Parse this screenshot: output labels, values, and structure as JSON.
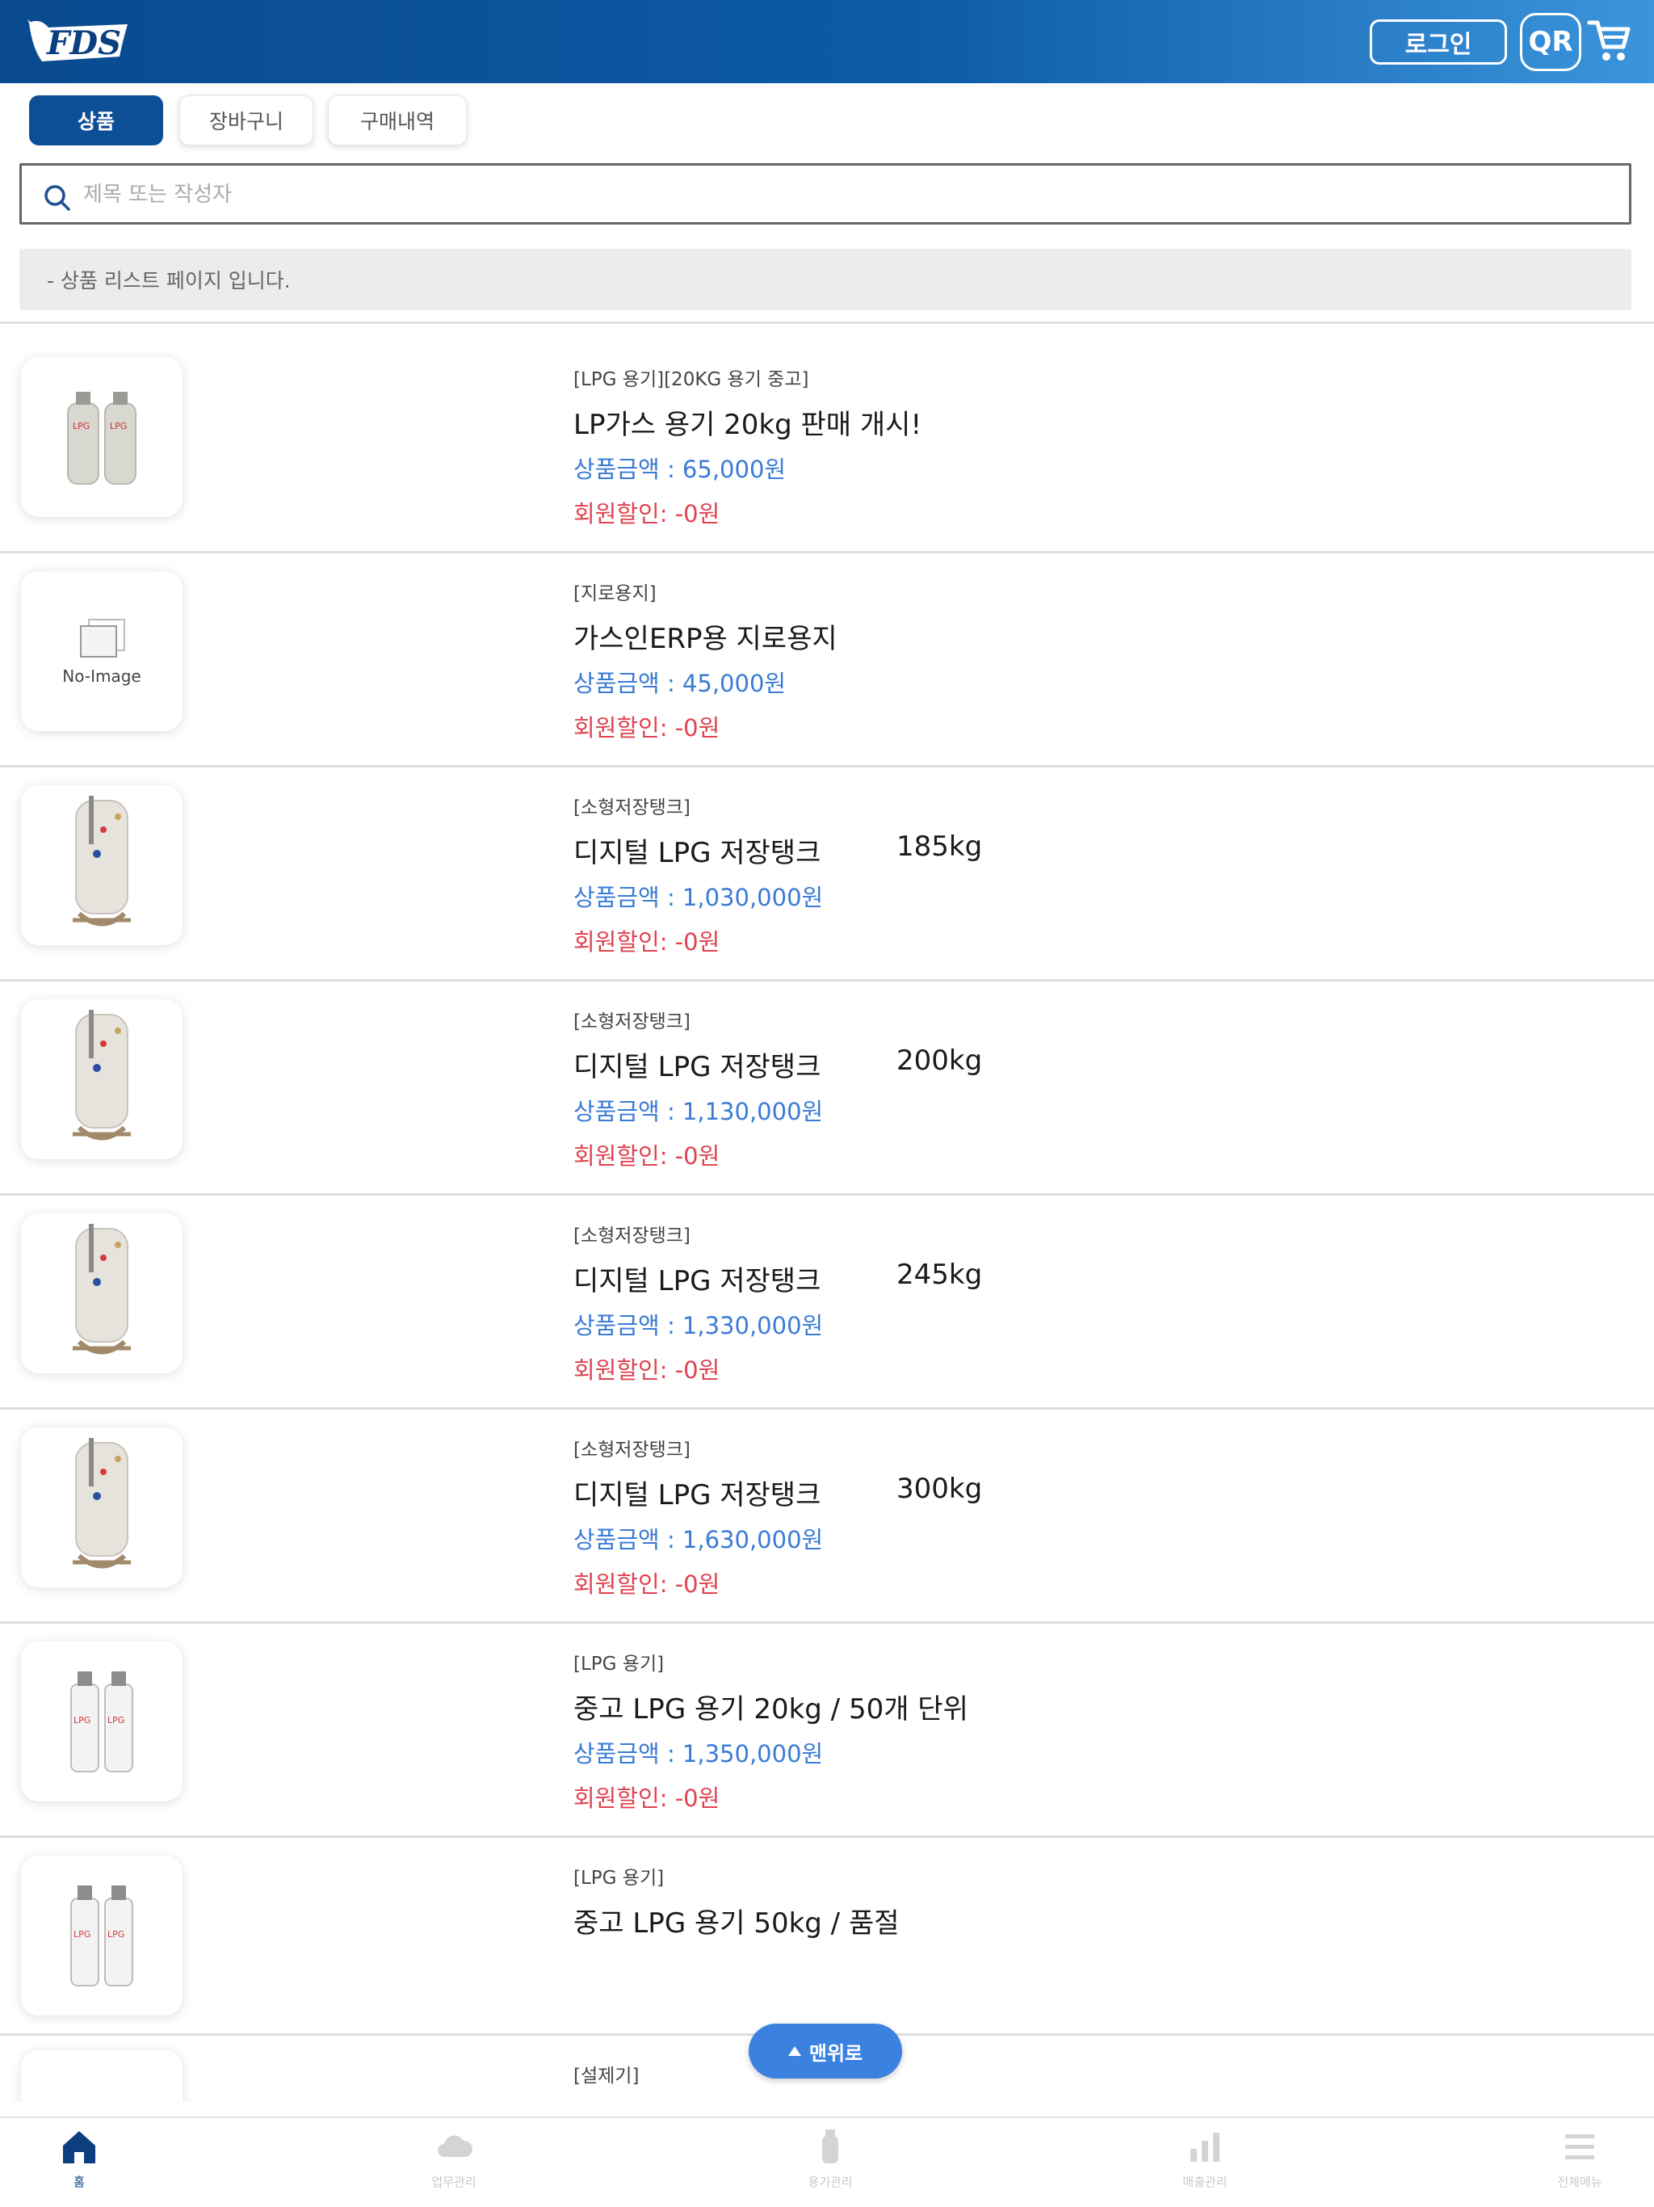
{
  "header": {
    "logo_text": "FDS",
    "login_label": "로그인",
    "qr_label": "QR",
    "cart_icon": "cart-icon",
    "accent_color": "#0d4f96"
  },
  "tabs": [
    {
      "label": "상품",
      "active": true
    },
    {
      "label": "장바구니",
      "active": false
    },
    {
      "label": "구매내역",
      "active": false
    }
  ],
  "search": {
    "placeholder": "제목 또는 작성자",
    "value": "",
    "icon": "search-icon"
  },
  "notice": "- 상품 리스트 페이지 입니다.",
  "products": [
    {
      "category": "[LPG 용기][20KG 용기 중고]",
      "name": "LP가스 용기 20kg 판매 개시!",
      "weight": "",
      "price": "상품금액 : 65,000원",
      "discount": "회원할인: -0원",
      "image": "twin-gas-cylinder-image"
    },
    {
      "category": "[지로용지]",
      "name": "가스인ERP용 지로용지",
      "weight": "",
      "price": "상품금액 : 45,000원",
      "discount": "회원할인: -0원",
      "image": "no-image",
      "no_image_label": "No-Image"
    },
    {
      "category": "[소형저장탱크]",
      "name": "디지털 LPG 저장탱크",
      "weight": "185kg",
      "price": "상품금액 : 1,030,000원",
      "discount": "회원할인: -0원",
      "image": "storage-tank-image"
    },
    {
      "category": "[소형저장탱크]",
      "name": "디지털 LPG 저장탱크",
      "weight": "200kg",
      "price": "상품금액 : 1,130,000원",
      "discount": "회원할인: -0원",
      "image": "storage-tank-image"
    },
    {
      "category": "[소형저장탱크]",
      "name": "디지털 LPG 저장탱크",
      "weight": "245kg",
      "price": "상품금액 : 1,330,000원",
      "discount": "회원할인: -0원",
      "image": "storage-tank-image"
    },
    {
      "category": "[소형저장탱크]",
      "name": "디지털 LPG 저장탱크",
      "weight": "300kg",
      "price": "상품금액 : 1,630,000원",
      "discount": "회원할인: -0원",
      "image": "storage-tank-image"
    },
    {
      "category": "[LPG 용기]",
      "name": "중고 LPG 용기 20kg / 50개 단위",
      "weight": "",
      "price": "상품금액 : 1,350,000원",
      "discount": "회원할인: -0원",
      "image": "lpg-cylinder-pair-image"
    },
    {
      "category": "[LPG 용기]",
      "name": "중고 LPG 용기 50kg / 품절",
      "weight": "",
      "price": "",
      "discount": "",
      "image": "lpg-cylinder-pair-image"
    },
    {
      "category": "[설제기]",
      "name": "",
      "weight": "",
      "price": "",
      "discount": "",
      "image": "equipment-image"
    }
  ],
  "scroll_top": {
    "label": "맨위로",
    "icon": "arrow-up-icon"
  },
  "bottom_nav": [
    {
      "label": "홈",
      "icon": "home-icon",
      "active": true
    },
    {
      "label": "업무관리",
      "icon": "cloud-icon",
      "active": false
    },
    {
      "label": "용기관리",
      "icon": "cylinder-icon",
      "active": false
    },
    {
      "label": "매출관리",
      "icon": "chart-icon",
      "active": false
    },
    {
      "label": "전체메뉴",
      "icon": "menu-icon",
      "active": false
    }
  ]
}
